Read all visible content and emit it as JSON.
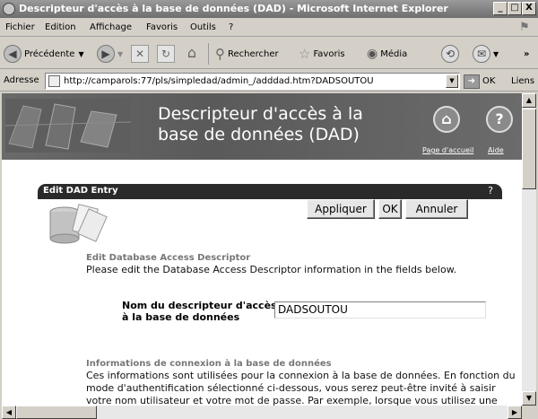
{
  "window": {
    "title": "Descripteur d'accès à la base de données (DAD) - Microsoft Internet Explorer",
    "buttons": [
      "_",
      "□",
      "X"
    ]
  },
  "menu": [
    "Fichier",
    "Edition",
    "Affichage",
    "Favoris",
    "Outils",
    "?"
  ],
  "toolbar": {
    "back_label": "Précédente",
    "search_label": "Rechercher",
    "favorites_label": "Favoris",
    "media_label": "Média",
    "more": "»"
  },
  "address": {
    "label": "Adresse",
    "url": "http://camparols:77/pls/simpledad/admin_/adddad.htm?DADSOUTOU",
    "go_label": "OK",
    "links_label": "Liens"
  },
  "banner": {
    "title_line1": "Descripteur d'accès à la",
    "title_line2": "base de données (DAD)",
    "home_link": "Page d'accueil",
    "help_link": "Aide"
  },
  "panel": {
    "title": "Edit DAD Entry",
    "help": "?",
    "buttons": {
      "apply": "Appliquer",
      "ok": "OK",
      "cancel": "Annuler"
    },
    "section_title": "Edit Database Access Descriptor",
    "section_text": "Please edit the Database Access Descriptor information in the fields below.",
    "field": {
      "label_line1": "Nom du descripteur d'accès",
      "label_line2": "à la base de données",
      "value": "DADSOUTOU"
    },
    "section2_title": "Informations de connexion à la base de données",
    "section2_text": "Ces informations sont utilisées pour la connexion à la base de données. En fonction du mode d'authentification sélectionné ci-dessous, vous serez peut-être invité à saisir votre nom utilisateur et votre mot de passe. Par exemple, lorsque vous utilisez une"
  }
}
